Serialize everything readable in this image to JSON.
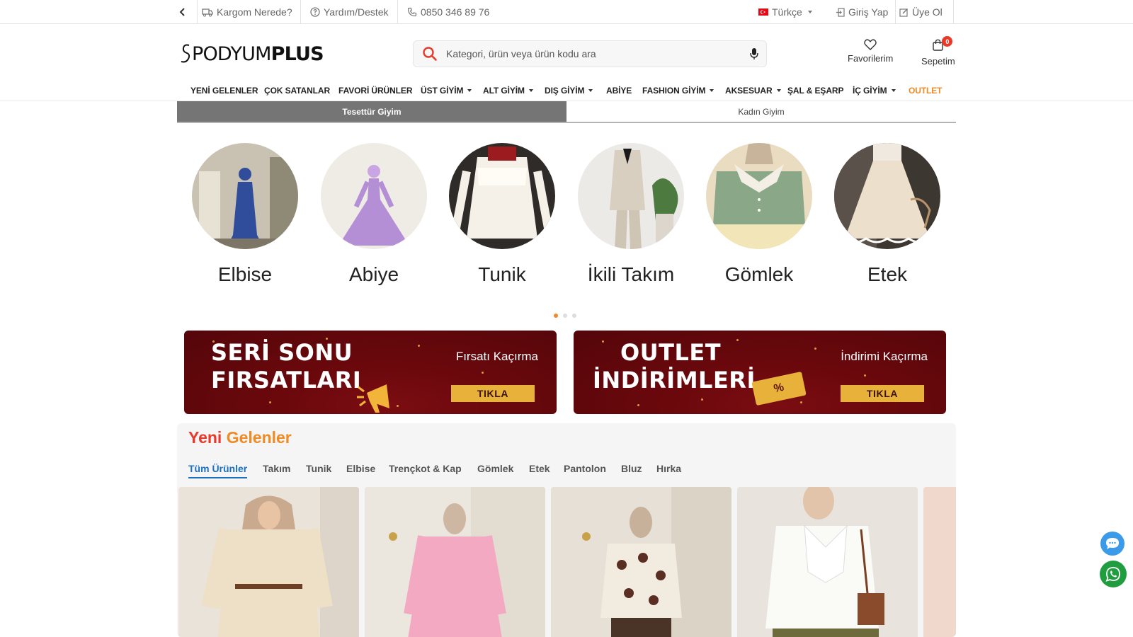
{
  "topbar": {
    "cargo": "Kargom Nerede?",
    "help": "Yardım/Destek",
    "phone": "0850 346 89 76",
    "language": "Türkçe",
    "login": "Giriş Yap",
    "register": "Üye Ol"
  },
  "header": {
    "logo_left": "PODYUM",
    "logo_right": "PLUS",
    "search_placeholder": "Kategori, ürün veya ürün kodu ara",
    "favorites": "Favorilerim",
    "cart": "Sepetim",
    "cart_count": "0"
  },
  "nav": {
    "items": [
      "YENİ GELENLER",
      "ÇOK SATANLAR",
      "FAVORİ ÜRÜNLER",
      "ÜST GİYİM",
      "ALT GİYİM",
      "DIŞ GİYİM",
      "ABİYE",
      "FASHION GİYİM",
      "AKSESUAR",
      "ŞAL & EŞARP",
      "İÇ GİYİM",
      "OUTLET"
    ]
  },
  "segments": {
    "tabs": [
      "Tesettür Giyim",
      "Kadın Giyim"
    ],
    "active": "Tesettür Giyim"
  },
  "categories": {
    "items": [
      "Elbise",
      "Abiye",
      "Tunik",
      "İkili Takım",
      "Gömlek",
      "Etek"
    ],
    "active_slide": 1,
    "slide_count": 3
  },
  "banners": [
    {
      "title_line1": "SERİ SONU",
      "title_line2": "FIRSATLARI",
      "subtitle": "Fırsatı Kaçırma",
      "cta": "TIKLA"
    },
    {
      "title_line1": "OUTLET",
      "title_line2": "İNDİRİMLERİ",
      "subtitle": "İndirimi Kaçırma",
      "cta": "TIKLA",
      "tag": "%"
    }
  ],
  "new_arrivals": {
    "title_part1": "Yeni",
    "title_part2": "Gelenler",
    "filters": [
      "Tüm Ürünler",
      "Takım",
      "Tunik",
      "Elbise",
      "Trençkot & Kap",
      "Gömlek",
      "Etek",
      "Pantolon",
      "Bluz",
      "Hırka"
    ],
    "active_filter": "Tüm Ürünler"
  },
  "colors": {
    "accent_orange": "#f08a24",
    "accent_red": "#e8392b",
    "active_filter_blue": "#1a70c2",
    "banner_red": "#6a080c",
    "banner_gold": "#e8b23a",
    "whatsapp_green": "#1f9d3f",
    "chat_blue": "#3b9be8"
  }
}
